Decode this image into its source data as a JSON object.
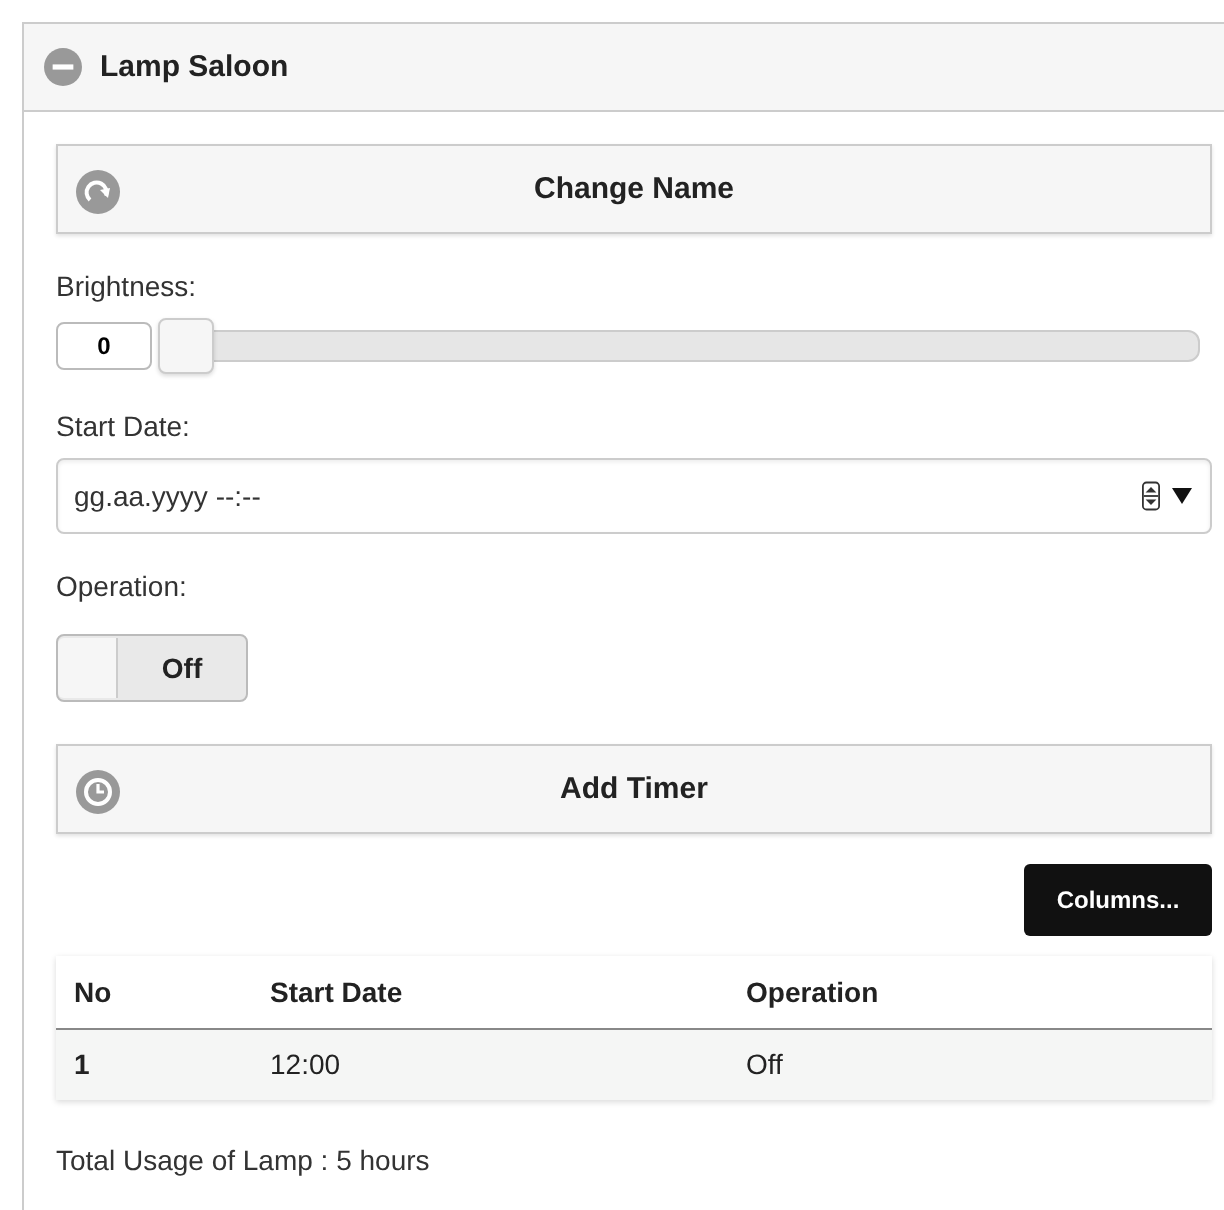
{
  "panel": {
    "title": "Lamp Saloon",
    "expanded": true
  },
  "change_name_button": {
    "label": "Change Name"
  },
  "brightness": {
    "label": "Brightness:",
    "value": "0",
    "level": 0
  },
  "start_date": {
    "label": "Start Date:",
    "placeholder": "gg.aa.yyyy --:--"
  },
  "operation": {
    "label": "Operation:",
    "on": false,
    "state_text": "Off"
  },
  "add_timer_button": {
    "label": "Add Timer"
  },
  "columns_button": {
    "label": "Columns..."
  },
  "table": {
    "columns": [
      "No",
      "Start Date",
      "Operation"
    ],
    "rows": [
      [
        "1",
        "12:00",
        "Off"
      ]
    ]
  },
  "footer": "Total Usage of Lamp : 5 hours"
}
